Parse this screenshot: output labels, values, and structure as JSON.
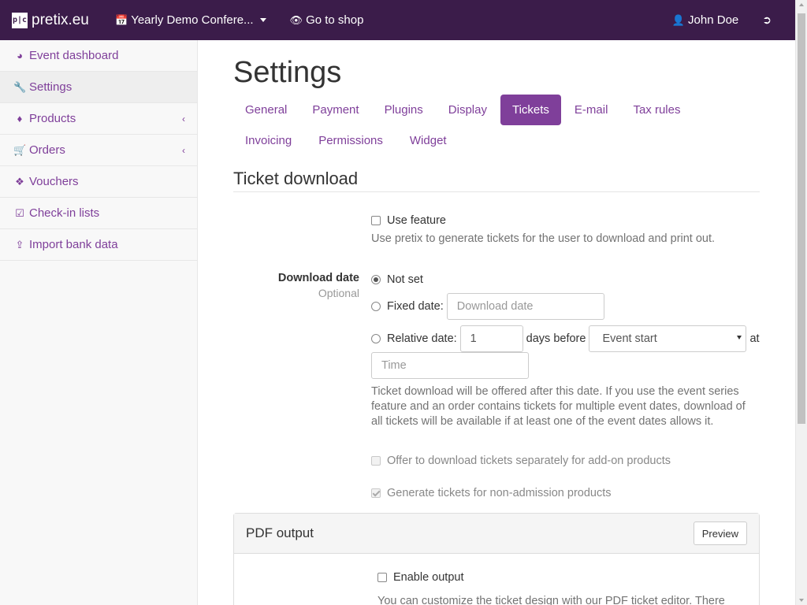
{
  "topbar": {
    "brand": "pretix.eu",
    "logo_text": "p|c",
    "event": "Yearly Demo Confere...",
    "shop_link": "Go to shop",
    "user": "John Doe"
  },
  "sidebar": {
    "items": [
      {
        "label": "Event dashboard",
        "icon": "dashboard-icon"
      },
      {
        "label": "Settings",
        "icon": "wrench-icon"
      },
      {
        "label": "Products",
        "icon": "ticket-icon"
      },
      {
        "label": "Orders",
        "icon": "cart-icon"
      },
      {
        "label": "Vouchers",
        "icon": "tags-icon"
      },
      {
        "label": "Check-in lists",
        "icon": "checkbox-icon"
      },
      {
        "label": "Import bank data",
        "icon": "upload-icon"
      }
    ]
  },
  "main": {
    "title": "Settings",
    "tabs": [
      {
        "label": "General"
      },
      {
        "label": "Payment"
      },
      {
        "label": "Plugins"
      },
      {
        "label": "Display"
      },
      {
        "label": "Tickets"
      },
      {
        "label": "E-mail"
      },
      {
        "label": "Tax rules"
      },
      {
        "label": "Invoicing"
      },
      {
        "label": "Permissions"
      },
      {
        "label": "Widget"
      }
    ],
    "active_tab": "Tickets",
    "section_title": "Ticket download",
    "use_feature": {
      "label": "Use feature",
      "checked": false,
      "help": "Use pretix to generate tickets for the user to download and print out."
    },
    "download_date": {
      "label": "Download date",
      "optional": "Optional",
      "options": {
        "not_set": "Not set",
        "fixed": "Fixed date:",
        "relative": "Relative date:"
      },
      "selected": "Not set",
      "fixed_placeholder": "Download date",
      "relative_value": "1",
      "days_before": "days before",
      "relative_base": "Event start",
      "at": "at",
      "time_placeholder": "Time",
      "help": "Ticket download will be offered after this date. If you use the event series feature and an order contains tickets for multiple event dates, download of all tickets will be available if at least one of the event dates allows it."
    },
    "addon_option": {
      "label": "Offer to download tickets separately for add-on products",
      "checked": false,
      "disabled": true
    },
    "nonadmission_option": {
      "label": "Generate tickets for non-admission products",
      "checked": true,
      "disabled": true
    },
    "pdf_panel": {
      "title": "PDF output",
      "preview": "Preview",
      "enable_output": "Enable output",
      "help_partial": "You can customize the ticket design with our PDF ticket editor. There"
    }
  },
  "colors": {
    "topbar_bg": "#3b1c4a",
    "accent": "#7f3f9a"
  }
}
